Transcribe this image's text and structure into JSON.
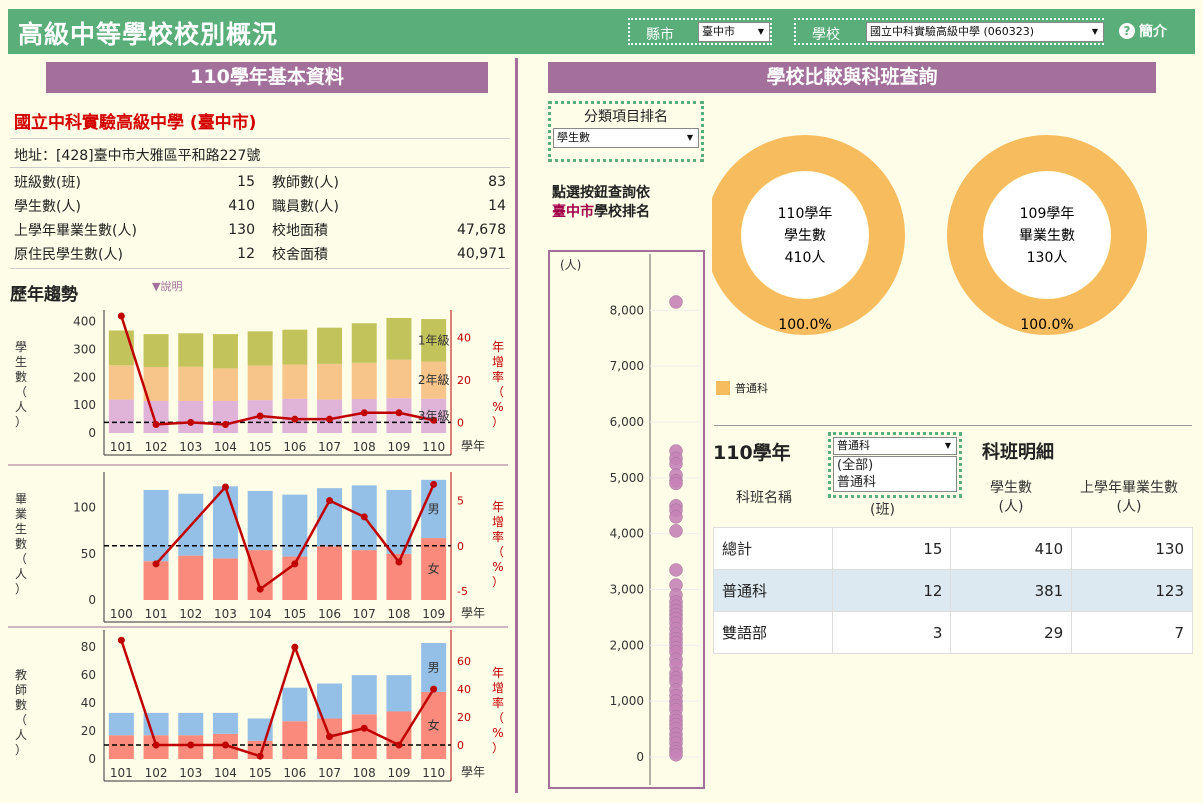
{
  "header": {
    "title": "高級中等學校校別概況",
    "city_label": "縣市",
    "city_value": "臺中市",
    "school_label": "學校",
    "school_value": "國立中科實驗高級中學 (060323)",
    "help_label": "簡介",
    "help_icon": "?"
  },
  "left": {
    "section_title": "110學年基本資料",
    "school_name": "國立中科實驗高級中學 (臺中市)",
    "address": "地址：[428]臺中市大雅區平和路227號",
    "stats_left": [
      {
        "label": "班級數(班)",
        "value": "15"
      },
      {
        "label": "學生數(人)",
        "value": "410"
      },
      {
        "label": "上學年畢業生數(人)",
        "value": "130"
      },
      {
        "label": "原住民學生數(人)",
        "value": "12"
      }
    ],
    "stats_right": [
      {
        "label": "教師數(人)",
        "value": "83"
      },
      {
        "label": "職員數(人)",
        "value": "14"
      },
      {
        "label": "校地面積",
        "value": "47,678"
      },
      {
        "label": "校舍面積",
        "value": "40,971"
      }
    ],
    "trend_title": "歷年趨勢",
    "note_label": "▼說明"
  },
  "right": {
    "section_title": "學校比較與科班查詢",
    "rank_label": "分類項目排名",
    "rank_value": "學生數",
    "click_prefix": "點選按鈕查詢依",
    "click_city": "臺中市",
    "click_suffix": "學校排名",
    "legend_label": "普通科",
    "donuts": [
      {
        "line1": "110學年",
        "line2": "學生數",
        "line3": "410人",
        "pct": "100.0%"
      },
      {
        "line1": "109學年",
        "line2": "畢業生數",
        "line3": "130人",
        "pct": "100.0%"
      }
    ],
    "class_year": "110學年",
    "class_detail": "科班明細",
    "class_filter_value": "普通科",
    "class_filter_options": [
      "(全部)",
      "普通科"
    ],
    "col_name": "科班名稱",
    "col_class_unit": "(班)",
    "col_students": "學生數",
    "col_students_unit": "(人)",
    "col_grads": "上學年畢業生數",
    "col_grads_unit": "(人)",
    "rows": [
      {
        "name": "總計",
        "classes": "15",
        "students": "410",
        "grads": "130"
      },
      {
        "name": "普通科",
        "classes": "12",
        "students": "381",
        "grads": "123"
      },
      {
        "name": "雙語部",
        "classes": "3",
        "students": "29",
        "grads": "7"
      }
    ]
  },
  "chart_data": [
    {
      "type": "bar",
      "title": "",
      "ylabel": "學生數(人)",
      "y2label": "年增率(%)",
      "xlabel": "學年",
      "categories": [
        "101",
        "102",
        "103",
        "104",
        "105",
        "106",
        "107",
        "108",
        "109",
        "110"
      ],
      "series": [
        {
          "name": "3年級",
          "values": [
            120,
            115,
            115,
            115,
            118,
            123,
            120,
            122,
            125,
            123
          ],
          "color": "#e0b3d9"
        },
        {
          "name": "2年級",
          "values": [
            123,
            122,
            123,
            117,
            124,
            123,
            128,
            130,
            138,
            133
          ],
          "color": "#f7c48a"
        },
        {
          "name": "1年級",
          "values": [
            125,
            118,
            120,
            123,
            123,
            125,
            130,
            142,
            150,
            153
          ],
          "color": "#c3c35c"
        }
      ],
      "rate": [
        50,
        -1,
        0,
        -1,
        3,
        1.5,
        1.5,
        4.5,
        4.5,
        1
      ],
      "ylim": [
        0,
        420
      ],
      "y2lim": [
        -5,
        50
      ],
      "yticks": [
        0,
        100,
        200,
        300,
        400
      ],
      "y2ticks": [
        0,
        20,
        40
      ]
    },
    {
      "type": "bar",
      "title": "",
      "ylabel": "畢業生數(人)",
      "y2label": "年增率(%)",
      "xlabel": "學年",
      "categories": [
        "100",
        "101",
        "102",
        "103",
        "104",
        "105",
        "106",
        "107",
        "108",
        "109"
      ],
      "series": [
        {
          "name": "女",
          "values": [
            0,
            42,
            48,
            45,
            54,
            47,
            58,
            54,
            50,
            67
          ],
          "color": "#fa8b7c"
        },
        {
          "name": "男",
          "values": [
            0,
            77,
            67,
            78,
            64,
            67,
            63,
            70,
            69,
            63
          ],
          "color": "#94bfe6"
        }
      ],
      "rate": [
        null,
        -2,
        null,
        6.5,
        -4.8,
        -2,
        5,
        3.2,
        -1.8,
        6.8
      ],
      "ylim": [
        0,
        132
      ],
      "y2lim": [
        -6,
        7.5
      ],
      "yticks": [
        0,
        50,
        100
      ],
      "y2ticks": [
        -5,
        0,
        5
      ]
    },
    {
      "type": "bar",
      "title": "",
      "ylabel": "教師數(人)",
      "y2label": "年增率(%)",
      "xlabel": "學年",
      "categories": [
        "101",
        "102",
        "103",
        "104",
        "105",
        "106",
        "107",
        "108",
        "109",
        "110"
      ],
      "series": [
        {
          "name": "女",
          "values": [
            17,
            17,
            17,
            18,
            13,
            27,
            29,
            32,
            34,
            48
          ],
          "color": "#fa8b7c"
        },
        {
          "name": "男",
          "values": [
            16,
            16,
            16,
            15,
            16,
            24,
            25,
            28,
            26,
            35
          ],
          "color": "#94bfe6"
        }
      ],
      "rate": [
        75,
        0,
        0,
        0,
        -8,
        70,
        6,
        12,
        0,
        40
      ],
      "ylim": [
        0,
        88
      ],
      "y2lim": [
        -10,
        78
      ],
      "yticks": [
        0,
        20,
        40,
        60,
        80
      ],
      "y2ticks": [
        0,
        20,
        40,
        60
      ]
    },
    {
      "type": "scatter",
      "title": "",
      "ylabel": "(人)",
      "ylim": [
        0,
        8400
      ],
      "yticks": [
        0,
        1000,
        2000,
        3000,
        4000,
        5000,
        6000,
        7000,
        8000
      ],
      "values": [
        8150,
        5480,
        5350,
        5250,
        5050,
        4950,
        4900,
        4500,
        4420,
        4300,
        4050,
        3350,
        3080,
        2900,
        2780,
        2700,
        2620,
        2550,
        2480,
        2400,
        2300,
        2200,
        2120,
        2050,
        1960,
        1880,
        1750,
        1650,
        1500,
        1420,
        1350,
        1200,
        1100,
        1000,
        920,
        850,
        720,
        650,
        580,
        510,
        410,
        330,
        250,
        150,
        90,
        40
      ]
    },
    {
      "type": "pie",
      "title": "",
      "slices": [
        {
          "label": "普通科",
          "value": 100.0,
          "color": "#f7bc5d"
        }
      ]
    },
    {
      "type": "pie",
      "title": "",
      "slices": [
        {
          "label": "普通科",
          "value": 100.0,
          "color": "#f7bc5d"
        }
      ]
    }
  ]
}
